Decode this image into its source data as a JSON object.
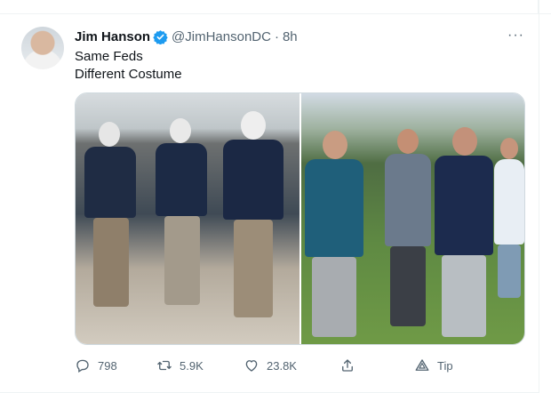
{
  "tweet": {
    "author_name": "Jim Hanson",
    "author_handle": "@JimHansonDC",
    "separator": "·",
    "time": "8h",
    "lines": [
      "Same Feds",
      "Different Costume"
    ],
    "more_label": "···"
  },
  "stats": {
    "replies": "798",
    "retweets": "5.9K",
    "likes": "23.8K",
    "tip_label": "Tip"
  },
  "icons": {
    "verified": "verified-badge-icon",
    "reply": "reply-icon",
    "retweet": "retweet-icon",
    "like": "heart-icon",
    "share": "share-icon",
    "tip": "tip-icon"
  },
  "colors": {
    "verified_blue": "#1d9bf0",
    "muted_text": "#536471",
    "primary_text": "#0f1419"
  }
}
